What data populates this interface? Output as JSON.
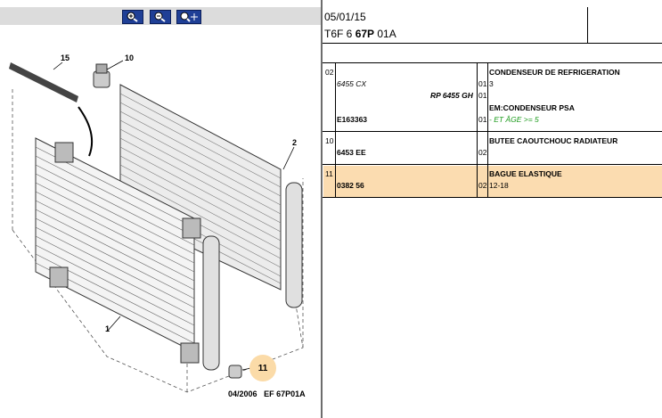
{
  "toolbar": {
    "buttons": [
      {
        "name": "zoom-in-icon",
        "label": "zoom in"
      },
      {
        "name": "zoom-out-icon",
        "label": "zoom out"
      },
      {
        "name": "zoom-fit-icon",
        "label": "zoom reset"
      }
    ]
  },
  "header": {
    "date": "05/01/15",
    "ref_prefix": "T6F 6 ",
    "ref_bold": "67P",
    "ref_suffix": " 01A"
  },
  "diagram": {
    "labels": [
      {
        "key": "15",
        "text": "15"
      },
      {
        "key": "10",
        "text": "10"
      },
      {
        "key": "2",
        "text": "2"
      },
      {
        "key": "1",
        "text": "1"
      }
    ],
    "callout": "11",
    "footer_date": "04/2006",
    "footer_code": "EF 67P01A"
  },
  "parts": {
    "header_num": "02",
    "rows": [
      {
        "num": "02",
        "line": "",
        "code": "",
        "qty": "",
        "title": "CONDENSEUR DE REFRIGERATION"
      },
      {
        "num": "",
        "line": "6455 CX",
        "code": "",
        "qty": "01",
        "title": "3"
      },
      {
        "num": "",
        "line": "",
        "code": "RP 6455 GH",
        "qty": "01",
        "title": ""
      },
      {
        "num": "",
        "line": "",
        "code": "",
        "qty": "",
        "title": "EM:CONDENSEUR PSA"
      },
      {
        "num": "",
        "line": "E163363",
        "code": "",
        "qty": "01",
        "title": "- ET ÂGE >= 5"
      },
      {
        "num": "10",
        "line": "",
        "code": "",
        "qty": "",
        "title": "BUTEE CAOUTCHOUC RADIATEUR"
      },
      {
        "num": "",
        "line": "6453 EE",
        "code": "",
        "qty": "02",
        "title": ""
      },
      {
        "num": "11",
        "line": "",
        "code": "",
        "qty": "",
        "title": "BAGUE ELASTIQUE"
      },
      {
        "num": "",
        "line": "0382 56",
        "code": "",
        "qty": "02",
        "title": "12-18"
      }
    ]
  },
  "colors": {
    "highlight": "#fbdcb0",
    "note_green": "#1a9a1a",
    "callout": "#fbdba8",
    "button": "#1f3f96"
  }
}
